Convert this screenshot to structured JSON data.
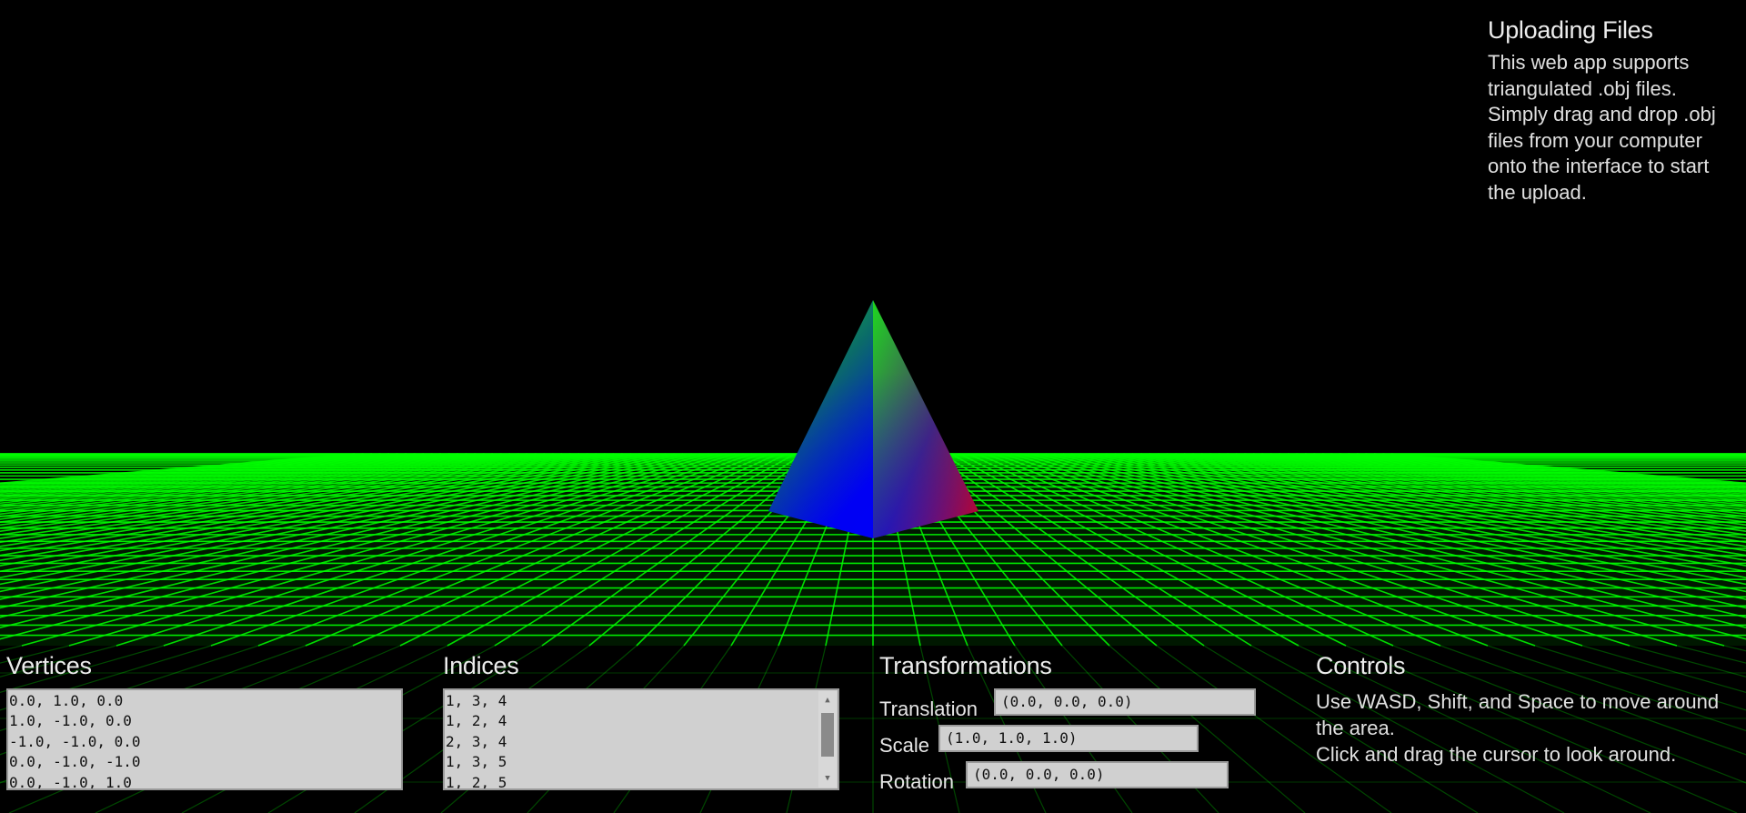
{
  "info": {
    "title": "Uploading Files",
    "lines": [
      "This web app supports",
      "triangulated .obj files.",
      "Simply drag and drop .obj",
      "files from your computer",
      "onto the interface to start",
      "the upload."
    ]
  },
  "vertices": {
    "title": "Vertices",
    "lines": [
      "0.0, 1.0, 0.0",
      "1.0, -1.0, 0.0",
      "-1.0, -1.0, 0.0",
      "0.0, -1.0, -1.0",
      "0.0, -1.0, 1.0"
    ]
  },
  "indices": {
    "title": "Indices",
    "lines": [
      "1, 3, 4",
      "1, 2, 4",
      "2, 3, 4",
      "1, 3, 5",
      "1, 2, 5"
    ]
  },
  "transformations": {
    "title": "Transformations",
    "translation_label": "Translation",
    "translation_value": "(0.0, 0.0, 0.0)",
    "scale_label": "Scale",
    "scale_value": "(1.0, 1.0, 1.0)",
    "rotation_label": "Rotation",
    "rotation_value": "(0.0, 0.0, 0.0)"
  },
  "controls": {
    "title": "Controls",
    "line1": "Use WASD, Shift, and Space to move around the area.",
    "line2": "Click and drag the cursor to look around."
  },
  "scene": {
    "background": "#000000",
    "grid_color": "#00ff00",
    "pyramid_colors": [
      "#00ff00",
      "#0000ff",
      "#ff0000"
    ]
  }
}
